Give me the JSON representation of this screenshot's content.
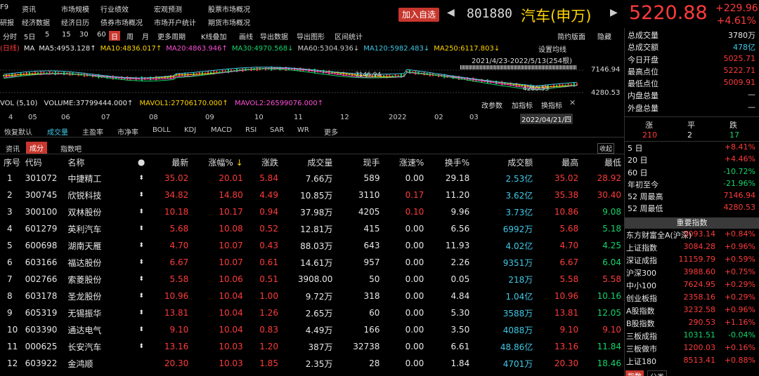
{
  "menu": {
    "f9": "F9",
    "row1": [
      "资讯",
      "市场规模",
      "行业绩效",
      "宏观预测",
      "股票市场概况"
    ],
    "row2": [
      "研报",
      "经济数据",
      "经济日历",
      "债券市场概况",
      "市场开户统计",
      "期货市场概况"
    ]
  },
  "header": {
    "add_label": "加入自选",
    "code": "801880",
    "name": "汽车(申万)",
    "price": "5220.88",
    "change": "+229.96",
    "change_pct": "+4.61%"
  },
  "toolbar": {
    "items": [
      "分时",
      "5日",
      "5",
      "15",
      "30",
      "60",
      "日",
      "周",
      "月",
      "更多周期",
      "K线叠加",
      "画线",
      "导出数据",
      "导出图形",
      "区间统计"
    ],
    "active": "日",
    "right_items": [
      "简约版面",
      "隐藏"
    ]
  },
  "ma": {
    "prefix": "(日线)",
    "label": "MA",
    "items": [
      {
        "text": "MA5:4953.128↑",
        "color": "#e8e8e8"
      },
      {
        "text": "MA10:4836.017↑",
        "color": "#ffd400"
      },
      {
        "text": "MA20:4863.946↑",
        "color": "#ff4fd8"
      },
      {
        "text": "MA30:4970.568↓",
        "color": "#16d36a"
      },
      {
        "text": "MA60:5304.936↓",
        "color": "#c8c8c8"
      },
      {
        "text": "MA120:5982.483↓",
        "color": "#3ec9e6"
      },
      {
        "text": "MA250:6117.803↓",
        "color": "#ffd400"
      }
    ]
  },
  "chart": {
    "settings": "设置均线",
    "range": "2021/4/23-2022/5/13(254根)",
    "high_label": "7146.94",
    "low_label": "4280.53",
    "axis_high": "7146.94",
    "axis_low": "4280.53",
    "date_ticks": [
      "4",
      "05",
      "06",
      "07",
      "08",
      "09",
      "10",
      "11",
      "12",
      "2022",
      "02",
      "03"
    ],
    "date_cursor": "2022/04/21/四"
  },
  "vol": {
    "label": "VOL (5,10)",
    "volume": "VOLUME:37799444.000↑",
    "mavol1": "MAVOL1:27706170.000↑",
    "mavol2": "MAVOL2:26599076.000↑",
    "actions": [
      "改参数",
      "加指标",
      "换指标"
    ]
  },
  "indicator_tabs": [
    "恢复默认",
    "成交量",
    "主盈率",
    "市净率",
    "BOLL",
    "KDJ",
    "MACD",
    "RSI",
    "SAR",
    "WR",
    "更多"
  ],
  "subtabs": [
    "资讯",
    "成分",
    "指数吧"
  ],
  "collapse_label": "收起",
  "table": {
    "headers": [
      "序号",
      "代码",
      "名称",
      "",
      "最新",
      "涨幅%",
      "涨跌",
      "成交量",
      "现手",
      "涨速%",
      "换手%",
      "成交额",
      "最高",
      "最低"
    ],
    "rows": [
      [
        "1",
        "301072",
        "中捷精工",
        "35.02",
        "20.01",
        "5.84",
        "7.66万",
        "589",
        "0.00",
        "29.18",
        "2.53亿",
        "35.02",
        "28.92"
      ],
      [
        "2",
        "300745",
        "欣锐科技",
        "34.82",
        "14.80",
        "4.49",
        "10.85万",
        "3110",
        "0.17",
        "11.20",
        "3.62亿",
        "35.38",
        "30.40"
      ],
      [
        "3",
        "300100",
        "双林股份",
        "10.18",
        "10.17",
        "0.94",
        "37.98万",
        "4205",
        "0.10",
        "9.96",
        "3.73亿",
        "10.86",
        "9.08"
      ],
      [
        "4",
        "601279",
        "英利汽车",
        "5.68",
        "10.08",
        "0.52",
        "12.81万",
        "415",
        "0.00",
        "6.56",
        "6992万",
        "5.68",
        "5.18"
      ],
      [
        "5",
        "600698",
        "湖南天雁",
        "4.70",
        "10.07",
        "0.43",
        "88.03万",
        "643",
        "0.00",
        "11.93",
        "4.02亿",
        "4.70",
        "4.25"
      ],
      [
        "6",
        "603166",
        "福达股份",
        "6.67",
        "10.07",
        "0.61",
        "14.61万",
        "957",
        "0.00",
        "2.26",
        "9351万",
        "6.67",
        "6.04"
      ],
      [
        "7",
        "002766",
        "索菱股份",
        "5.58",
        "10.06",
        "0.51",
        "3908.00",
        "50",
        "0.00",
        "0.05",
        "218万",
        "5.58",
        "5.58"
      ],
      [
        "8",
        "603178",
        "圣龙股份",
        "10.96",
        "10.04",
        "1.00",
        "9.72万",
        "318",
        "0.00",
        "4.84",
        "1.04亿",
        "10.96",
        "10.16"
      ],
      [
        "9",
        "605319",
        "无锡振华",
        "13.81",
        "10.04",
        "1.26",
        "2.65万",
        "60",
        "0.00",
        "5.30",
        "3588万",
        "13.81",
        "12.05"
      ],
      [
        "10",
        "603390",
        "通达电气",
        "9.10",
        "10.04",
        "0.83",
        "4.49万",
        "166",
        "0.00",
        "3.50",
        "4088万",
        "9.10",
        "9.10"
      ],
      [
        "11",
        "000625",
        "长安汽车",
        "13.16",
        "10.03",
        "1.20",
        "387万",
        "32738",
        "0.00",
        "6.61",
        "48.86亿",
        "13.16",
        "11.84"
      ],
      [
        "12",
        "603922",
        "金鸿顺",
        "20.30",
        "10.03",
        "1.85",
        "2.35万",
        "28",
        "0.00",
        "1.84",
        "4701万",
        "20.30",
        "18.46"
      ]
    ],
    "low_colors": [
      "red",
      "red",
      "green",
      "green",
      "green",
      "green",
      "red",
      "green",
      "green",
      "red",
      "green",
      "green"
    ],
    "pin_rows": [
      0,
      1,
      2,
      3,
      4,
      5,
      6,
      7,
      8,
      9,
      10
    ]
  },
  "stats": [
    {
      "k": "总成交量",
      "v": "3780万",
      "c": "white"
    },
    {
      "k": "总成交额",
      "v": "478亿",
      "c": "cyan"
    },
    {
      "k": "今日开盘",
      "v": "5025.71",
      "c": "red"
    },
    {
      "k": "最高点位",
      "v": "5222.71",
      "c": "red"
    },
    {
      "k": "最低点位",
      "v": "5009.91",
      "c": "red"
    },
    {
      "k": "内盘总量",
      "v": "—",
      "c": "white"
    },
    {
      "k": "外盘总量",
      "v": "—",
      "c": "white"
    }
  ],
  "breadth": {
    "labels": [
      "涨",
      "平",
      "跌"
    ],
    "values": [
      "210",
      "2",
      "17"
    ]
  },
  "periods": [
    {
      "k": "5 日",
      "v": "+8.41%",
      "c": "red"
    },
    {
      "k": "20 日",
      "v": "+4.46%",
      "c": "red"
    },
    {
      "k": "60 日",
      "v": "-10.72%",
      "c": "green"
    },
    {
      "k": "年初至今",
      "v": "-21.96%",
      "c": "green"
    },
    {
      "k": "52 周最高",
      "v": "7146.94",
      "c": "red"
    },
    {
      "k": "52 周最低",
      "v": "4280.53",
      "c": "red"
    }
  ],
  "indices_title": "重要指数",
  "indices": [
    {
      "k": "东方财富全A(沪深)",
      "p": "5093.14",
      "c": "+0.84%"
    },
    {
      "k": "上证指数",
      "p": "3084.28",
      "c": "+0.96%"
    },
    {
      "k": "深证成指",
      "p": "11159.79",
      "c": "+0.59%"
    },
    {
      "k": "沪深300",
      "p": "3988.60",
      "c": "+0.75%"
    },
    {
      "k": "中小100",
      "p": "7624.95",
      "c": "+0.29%"
    },
    {
      "k": "创业板指",
      "p": "2358.16",
      "c": "+0.29%"
    },
    {
      "k": "A股指数",
      "p": "3232.58",
      "c": "+0.96%"
    },
    {
      "k": "B股指数",
      "p": "290.53",
      "c": "+1.16%"
    },
    {
      "k": "三板成指",
      "p": "1031.51",
      "c": "-0.04%"
    },
    {
      "k": "三板做市",
      "p": "1200.03",
      "c": "+0.16%"
    },
    {
      "k": "上证180",
      "p": "8513.41",
      "c": "+0.88%"
    }
  ],
  "bottom_tabs": [
    "指数",
    "分类"
  ]
}
